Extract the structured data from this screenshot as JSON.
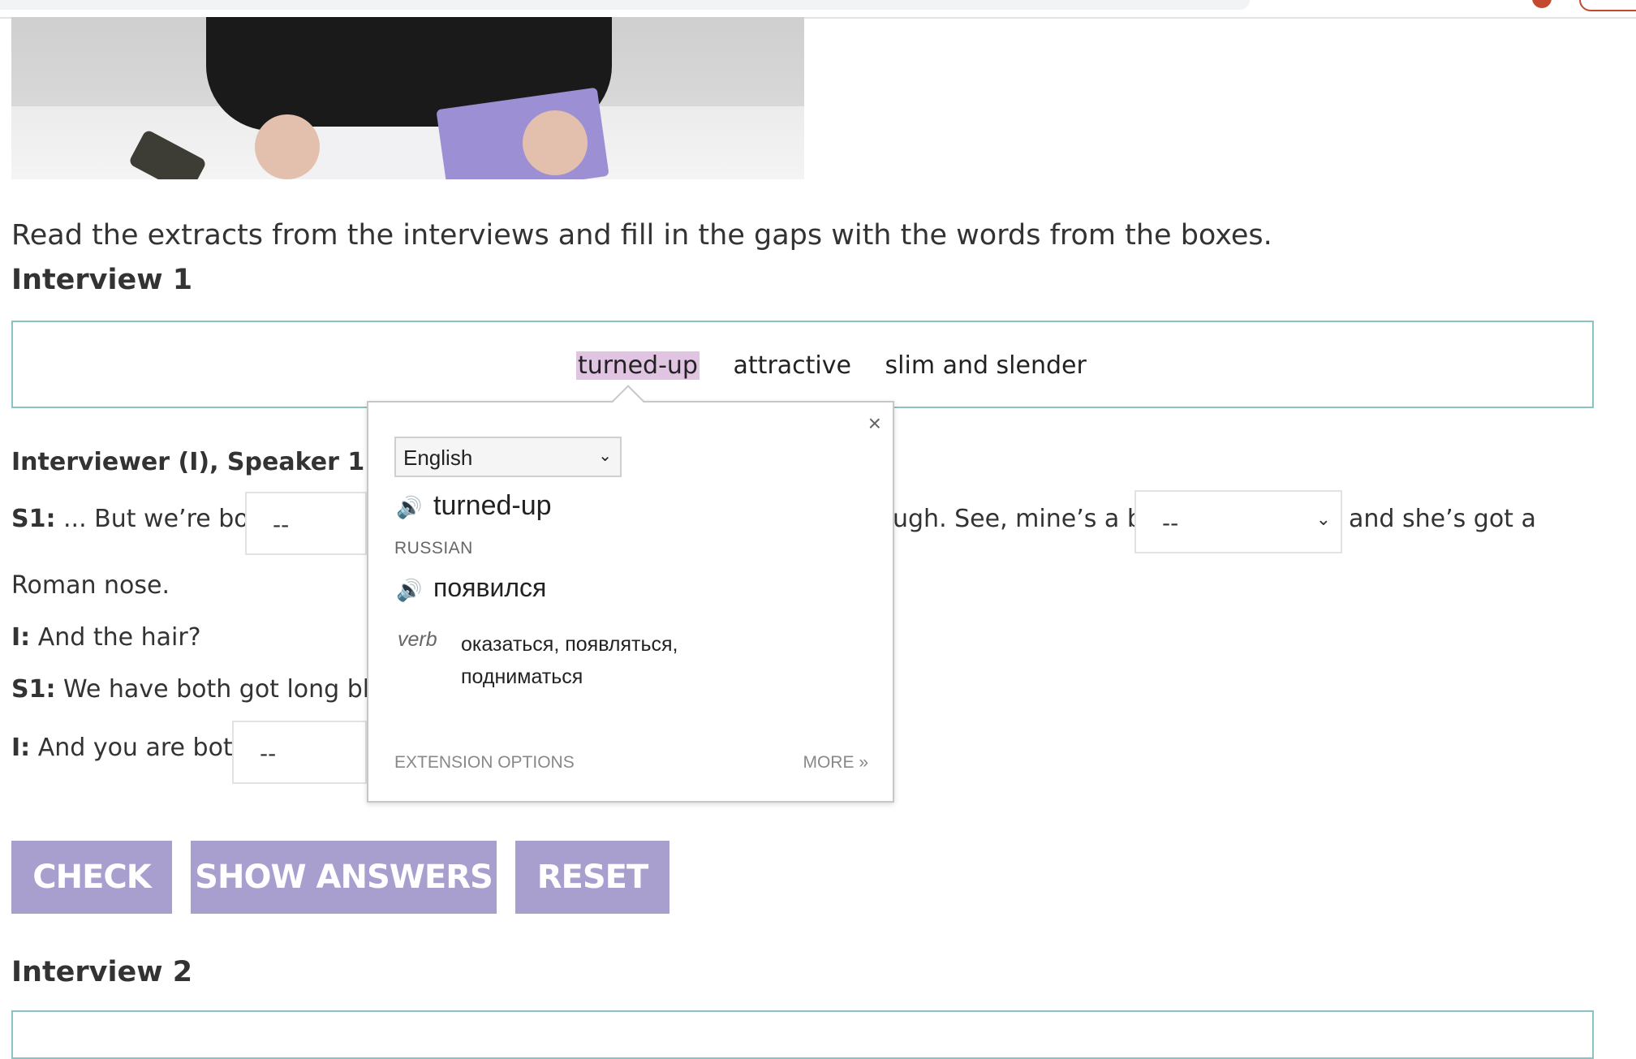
{
  "instruction": "Read the extracts from the interviews and fill in the gaps with the words from the boxes.",
  "interview1": {
    "heading": "Interview 1",
    "words": [
      "turned-up",
      "attractive",
      "slim and slender"
    ],
    "speaker_heading": "Interviewer (I), Speaker 1 (S1)",
    "lines": {
      "s1_label": "S1:",
      "s1_text_a": " ... But we’re both",
      "s1_text_b": "ugh. See, mine’s a bit",
      "s1_text_c": "and she’s got a",
      "roman": "Roman nose.",
      "i1_label": "I:",
      "i1_text": " And the hair?",
      "s1b_label": "S1:",
      "s1b_text": " We have both got long black",
      "i2_label": "I:",
      "i2_text": " And you are both,"
    },
    "dropdowns": [
      "--",
      "--",
      "--"
    ]
  },
  "buttons": {
    "check": "CHECK",
    "show_answers": "SHOW ANSWERS",
    "reset": "RESET"
  },
  "interview2": {
    "heading": "Interview 2"
  },
  "popup": {
    "close": "×",
    "source_language": "English",
    "source_word": "turned-up",
    "target_language": "RUSSIAN",
    "translation": "появился",
    "part_of_speech": "verb",
    "synonyms": "оказаться, появляться, подниматься",
    "extension_options": "EXTENSION OPTIONS",
    "more": "MORE »",
    "speaker_icon": "🔊"
  },
  "colors": {
    "button_bg": "#a89fce",
    "box_border": "#8bc3c3",
    "selected_word_bg": "#e0c4e2"
  }
}
